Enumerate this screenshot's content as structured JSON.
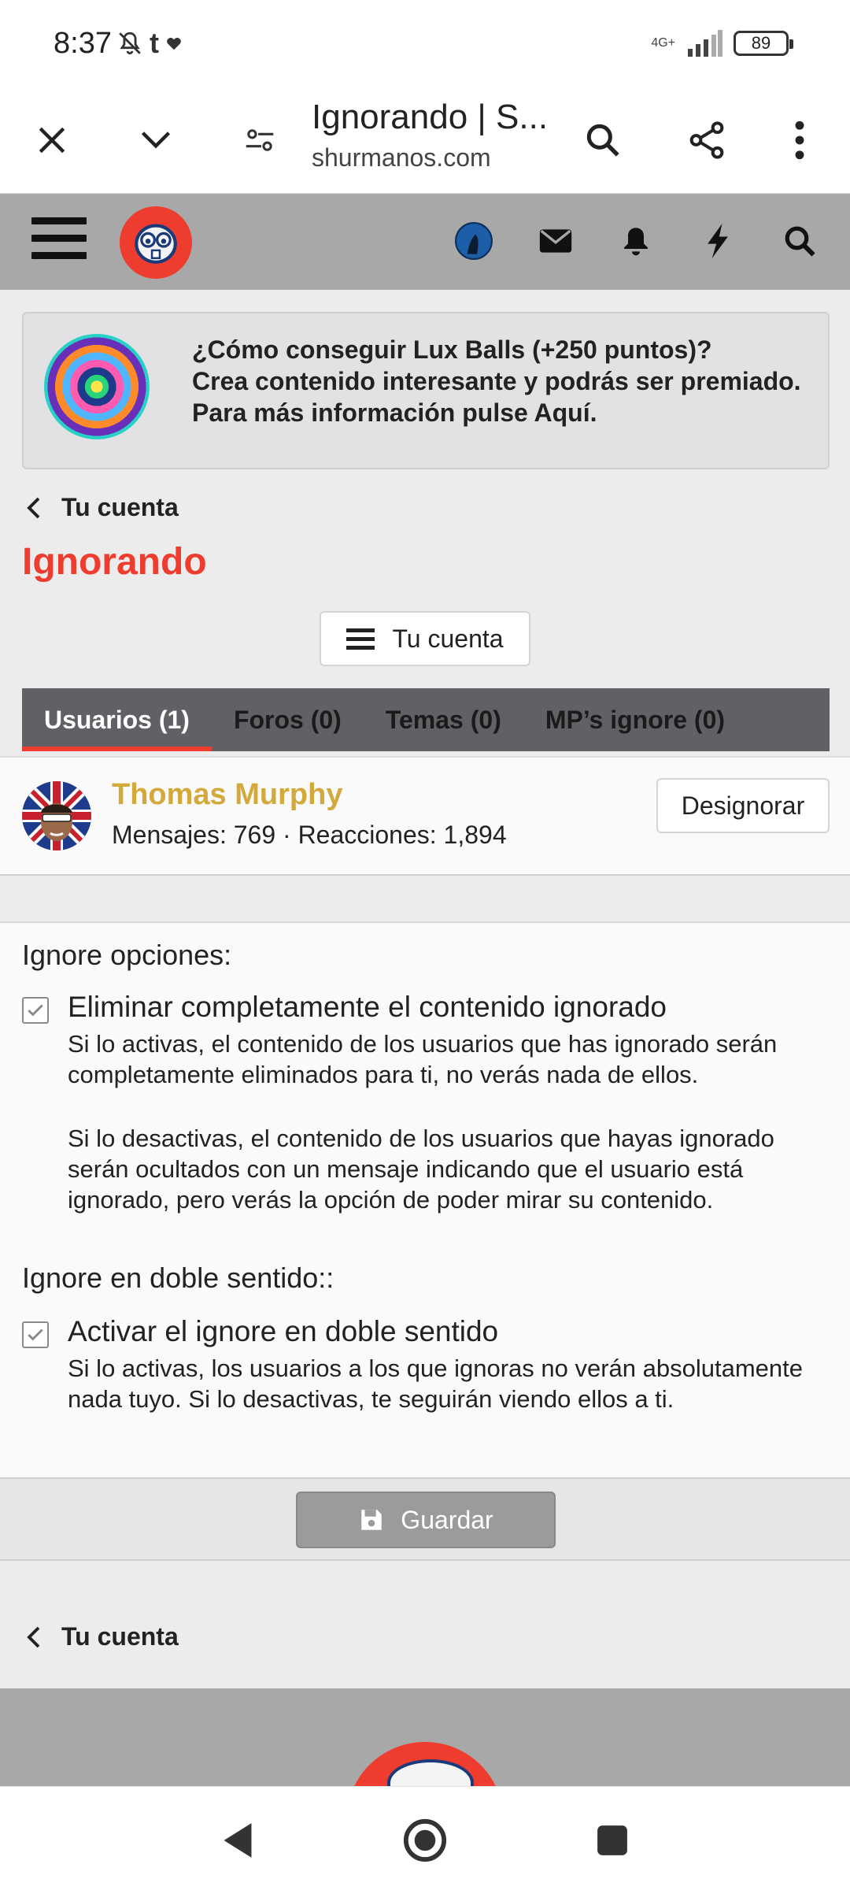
{
  "status_bar": {
    "time": "8:37",
    "network": "4G+",
    "battery": "89"
  },
  "browser": {
    "title": "Ignorando | S...",
    "url": "shurmanos.com"
  },
  "notice": {
    "line1": "¿Cómo conseguir Lux Balls (+250 puntos)?",
    "line2": "Crea contenido interesante y podrás ser premiado.",
    "line3": "Para más información pulse Aquí."
  },
  "breadcrumb": {
    "label": "Tu cuenta"
  },
  "page": {
    "title": "Ignorando",
    "menu_button": "Tu cuenta"
  },
  "tabs": [
    {
      "label": "Usuarios (1)"
    },
    {
      "label": "Foros (0)"
    },
    {
      "label": "Temas (0)"
    },
    {
      "label": "MP’s ignore (0)"
    }
  ],
  "ignored_user": {
    "name": "Thomas Murphy",
    "meta": "Mensajes: 769 · Reacciones: 1,894",
    "action": "Designorar"
  },
  "options": {
    "heading1": "Ignore opciones:",
    "opt1_label": "Eliminar completamente el contenido ignorado",
    "opt1_desc1": "Si lo activas, el contenido de los usuarios que has ignorado serán completamente eliminados para ti, no verás nada de ellos.",
    "opt1_desc2": "Si lo desactivas, el contenido de los usuarios que hayas ignorado serán ocultados con un mensaje indicando que el usuario está ignorado, pero verás la opción de poder mirar su contenido.",
    "heading2": "Ignore en doble sentido::",
    "opt2_label": "Activar el ignore en doble sentido",
    "opt2_desc": "Si lo activas, los usuarios a los que ignoras no verán absolutamente nada tuyo. Si lo desactivas, te seguirán viendo ellos a ti."
  },
  "save": {
    "label": "Guardar"
  },
  "breadcrumb_bottom": {
    "label": "Tu cuenta"
  },
  "colors": {
    "accent": "#ee3d2f",
    "username": "#d2a93a",
    "tabs_bg": "#5f6164",
    "header_bg": "#a8a8a8"
  }
}
